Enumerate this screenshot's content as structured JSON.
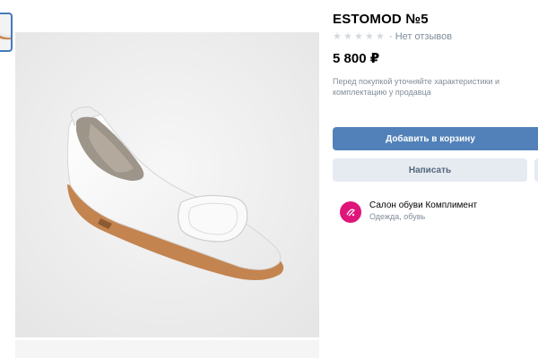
{
  "product": {
    "title": "ESTOMOD №5",
    "rating_text": "· Нет отзывов",
    "stars": 5,
    "price": "5 800 ₽",
    "notice": "Перед покупкой уточняйте характеристики и комплектацию у продавца"
  },
  "actions": {
    "add_to_cart": "Добавить в корзину",
    "write": "Написать"
  },
  "seller": {
    "name": "Салон обуви Комплимент",
    "category": "Одежда, обувь"
  },
  "colors": {
    "accent": "#5181b8",
    "secondary_button": "#e5ebf1",
    "seller_avatar": "#e0157a",
    "muted_text": "#818c99"
  },
  "icons": {
    "star": "star-icon",
    "avatar": "seller-logo-icon"
  }
}
